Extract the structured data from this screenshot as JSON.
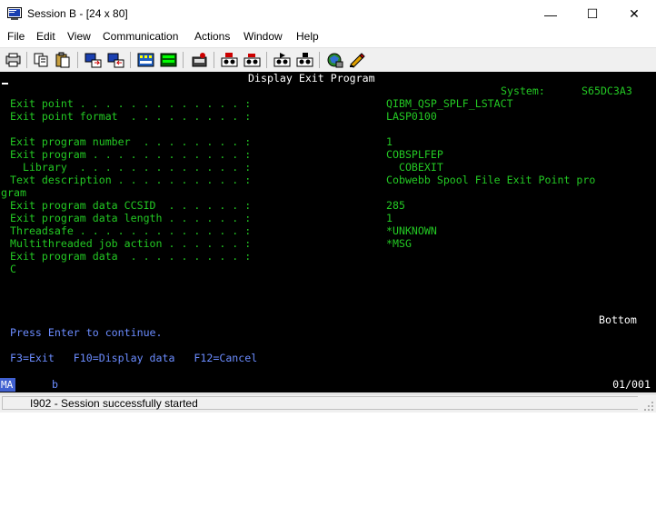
{
  "window": {
    "title": "Session B - [24 x 80]",
    "minimize_glyph": "—",
    "maximize_glyph": "☐",
    "close_glyph": "✕"
  },
  "menu": [
    "File",
    "Edit",
    "View",
    "Communication",
    "Actions",
    "Window",
    "Help"
  ],
  "toolbar_icons": [
    "print-screen-icon",
    "copy-icon",
    "paste-icon",
    "send-icon",
    "receive-icon",
    "display-keypad-icon",
    "color-map-icon",
    "record-macro-icon",
    "stop-macro-icon",
    "play-macro-icon",
    "macro-icon",
    "host-session-icon",
    "customize-icon"
  ],
  "screen": {
    "header": "Display Exit Program",
    "system_label": "System:",
    "system_value": "S65DC3A3",
    "fields": [
      {
        "label": "Exit point . . . . . . . . . . . . . :",
        "value": "QIBM_QSP_SPLF_LSTACT"
      },
      {
        "label": "Exit point format  . . . . . . . . . :",
        "value": "LASP0100"
      },
      {
        "label": "Exit program number  . . . . . . . . :",
        "value": "1"
      },
      {
        "label": "Exit program . . . . . . . . . . . . :",
        "value": "COBSPLFEP"
      },
      {
        "label": "  Library  . . . . . . . . . . . . . :",
        "value": "  COBEXIT"
      },
      {
        "label": "Text description . . . . . . . . . . :",
        "value": "Cobwebb Spool File Exit Point pro"
      },
      {
        "label": "Exit program data CCSID  . . . . . . :",
        "value": "285"
      },
      {
        "label": "Exit program data length . . . . . . :",
        "value": "1"
      },
      {
        "label": "Threadsafe . . . . . . . . . . . . . :",
        "value": "*UNKNOWN"
      },
      {
        "label": "Multithreaded job action . . . . . . :",
        "value": "*MSG"
      },
      {
        "label": "Exit program data  . . . . . . . . . :",
        "value": ""
      }
    ],
    "text_continuation": "gram",
    "program_data": "C",
    "bottom": "Bottom",
    "press_enter": "Press Enter to continue.",
    "function_keys": "F3=Exit   F10=Display data   F12=Cancel"
  },
  "oia": {
    "mode": "MA",
    "indicator": "b",
    "cursor_pos": "01/001"
  },
  "status": {
    "message": "I902 - Session successfully started"
  },
  "colors": {
    "terminal_bg": "#000000",
    "green": "#23c823",
    "white": "#ffffff",
    "blue": "#6b8cff"
  }
}
